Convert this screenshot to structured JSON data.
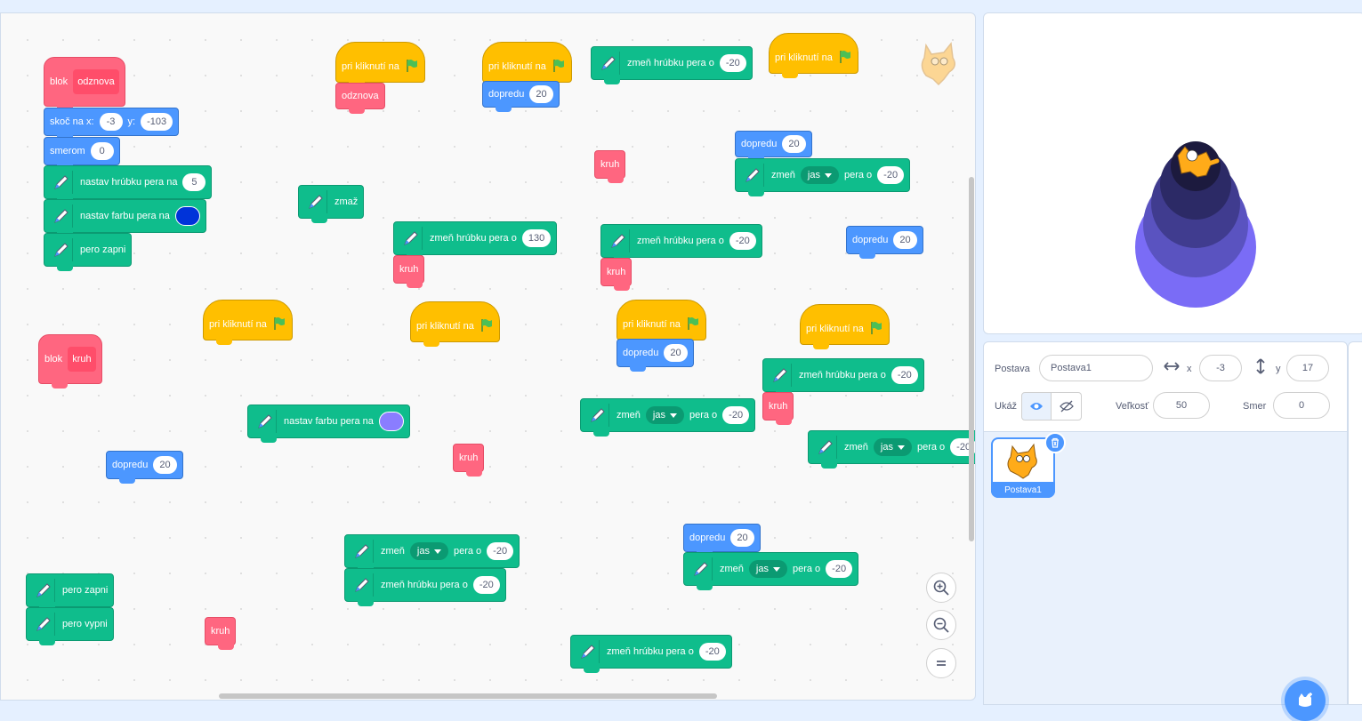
{
  "labels": {
    "pen_width_change": "zmeň hrúbku pera o",
    "pen_width_set": "nastav hrúbku pera na",
    "pen_color_set": "nastav farbu pera na",
    "pen_param_change": "zmeň",
    "pen_param_suffix": "pera o",
    "pen_down": "pero zapni",
    "pen_up": "pero vypni",
    "clear": "zmaž",
    "forward": "dopredu",
    "when_flag": "pri kliknutí na",
    "goto_x": "skoč na x:",
    "goto_y": "y:",
    "point_dir": "smerom",
    "define": "blok",
    "kruh": "kruh",
    "odznova": "odznova",
    "jas": "jas"
  },
  "values": {
    "goto_x": "-3",
    "goto_y": "-103",
    "direction": "0",
    "pen_size": "5",
    "change_neg20": "-20",
    "change_130": "130",
    "forward_20": "20"
  },
  "colors": {
    "pen_color_dark_blue": "#0033d9",
    "pen_color_light": "#8a7dff"
  },
  "sprite_info": {
    "sprite_label": "Postava",
    "sprite_name": "Postava1",
    "x_label": "x",
    "x_value": "-3",
    "y_label": "y",
    "y_value": "17",
    "show_label": "Ukáž",
    "size_label": "Veľkosť",
    "size_value": "50",
    "direction_label": "Smer",
    "direction_value": "0"
  },
  "sprite_list": [
    {
      "name": "Postava1"
    }
  ],
  "zoom": {
    "in": "+",
    "out": "−",
    "reset": "="
  }
}
